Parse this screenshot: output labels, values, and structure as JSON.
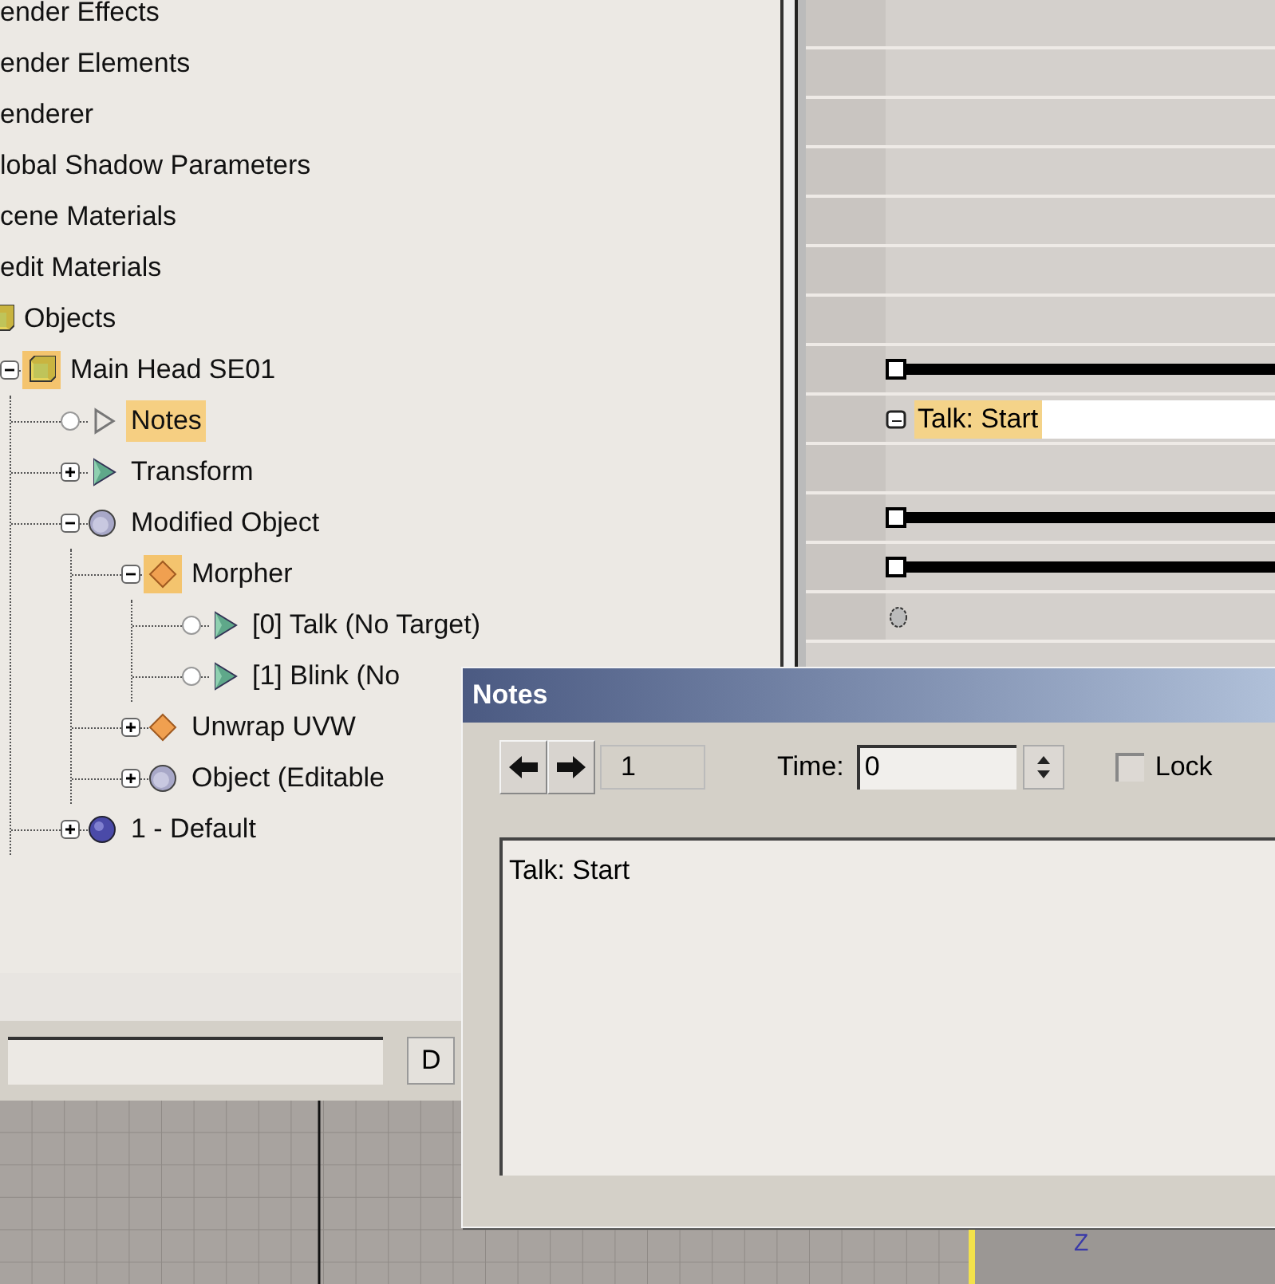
{
  "tree": [
    {
      "label": "ender Effects",
      "selected": false
    },
    {
      "label": "ender Elements",
      "selected": false
    },
    {
      "label": "enderer",
      "selected": false
    },
    {
      "label": "lobal Shadow Parameters",
      "selected": false
    },
    {
      "label": "cene Materials",
      "selected": false
    },
    {
      "label": "edit Materials",
      "selected": false
    },
    {
      "label": "Objects",
      "kind": "box",
      "selected": false,
      "icon_highlighted": false,
      "children": [
        {
          "label": "Main Head SE01",
          "kind": "box",
          "expanded": true,
          "selected": false,
          "icon_highlighted": true,
          "children": [
            {
              "label": "Notes",
              "kind": "triangle-outline",
              "leaf": true,
              "selected": true,
              "icon_highlighted": false
            },
            {
              "label": "Transform",
              "kind": "triangle",
              "expanded": false,
              "selected": false,
              "icon_highlighted": false
            },
            {
              "label": "Modified Object",
              "kind": "sphere-gray",
              "expanded": true,
              "selected": false,
              "icon_highlighted": false,
              "children": [
                {
                  "label": "Morpher",
                  "kind": "diamond",
                  "expanded": true,
                  "selected": false,
                  "icon_highlighted": true,
                  "children": [
                    {
                      "label": "[0] Talk  (No Target)",
                      "kind": "triangle",
                      "leaf": true,
                      "selected": false,
                      "icon_highlighted": false
                    },
                    {
                      "label": "[1] Blink  (No",
                      "kind": "triangle",
                      "leaf": true,
                      "selected": false,
                      "icon_highlighted": false
                    }
                  ]
                },
                {
                  "label": "Unwrap UVW",
                  "kind": "diamond",
                  "expanded": false,
                  "selected": false,
                  "icon_highlighted": false
                },
                {
                  "label": "Object (Editable",
                  "kind": "sphere-gray",
                  "expanded": false,
                  "selected": false,
                  "icon_highlighted": false
                }
              ]
            },
            {
              "label": "1 - Default",
              "kind": "sphere-blue",
              "expanded": false,
              "selected": false,
              "icon_highlighted": false
            }
          ]
        }
      ]
    }
  ],
  "track_rows": [
    {
      "kind": "empty"
    },
    {
      "kind": "empty"
    },
    {
      "kind": "empty"
    },
    {
      "kind": "empty"
    },
    {
      "kind": "empty"
    },
    {
      "kind": "empty"
    },
    {
      "kind": "empty"
    },
    {
      "kind": "key-bar"
    },
    {
      "kind": "note",
      "text": "Talk: Start"
    },
    {
      "kind": "empty"
    },
    {
      "kind": "key-bar"
    },
    {
      "kind": "key-bar"
    },
    {
      "kind": "key-dot"
    }
  ],
  "bottom_bar": {
    "button": "D"
  },
  "notes_dialog": {
    "title": "Notes",
    "index": "1",
    "time_label": "Time:",
    "time_value": "0",
    "lock": {
      "label": "Lock",
      "checked": false
    },
    "text": "Talk: Start"
  },
  "viewport": {
    "axis_label": "Z"
  }
}
